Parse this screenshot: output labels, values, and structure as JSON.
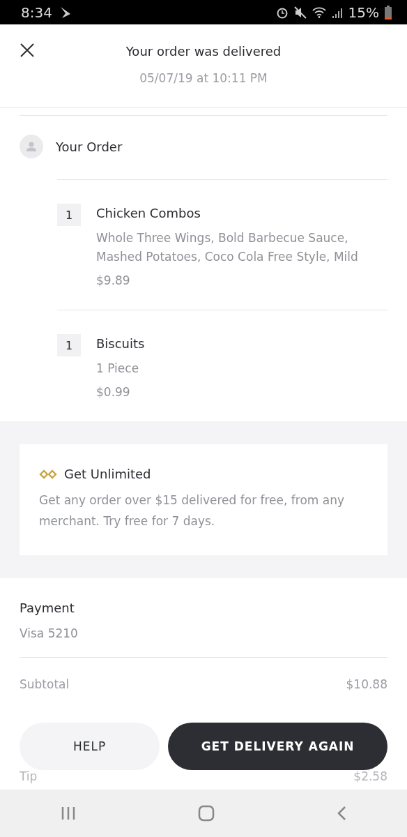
{
  "status_bar": {
    "time": "8:34",
    "battery": "15%"
  },
  "header": {
    "title": "Your order was delivered",
    "subtitle": "05/07/19 at 10:11 PM"
  },
  "order": {
    "title": "Your Order",
    "items": [
      {
        "quantity": "1",
        "name": "Chicken Combos",
        "options": "Whole Three Wings, Bold Barbecue Sauce, Mashed Potatoes, Coco Cola Free Style, Mild",
        "price": "$9.89"
      },
      {
        "quantity": "1",
        "name": "Biscuits",
        "options": "1 Piece",
        "price": "$0.99"
      }
    ]
  },
  "promo": {
    "title": "Get Unlimited",
    "text": "Get any order over $15 delivered for free, from any merchant. Try free for 7 days."
  },
  "payment": {
    "title": "Payment",
    "method": "Visa 5210"
  },
  "summary": [
    {
      "label": "Subtotal",
      "value": "$10.88",
      "faded": false
    },
    {
      "label": "Tip",
      "value": "$2.58",
      "faded": true
    }
  ],
  "buttons": [
    {
      "label": "HELP",
      "kind": "secondary"
    },
    {
      "label": "GET DELIVERY AGAIN",
      "kind": "primary"
    }
  ]
}
